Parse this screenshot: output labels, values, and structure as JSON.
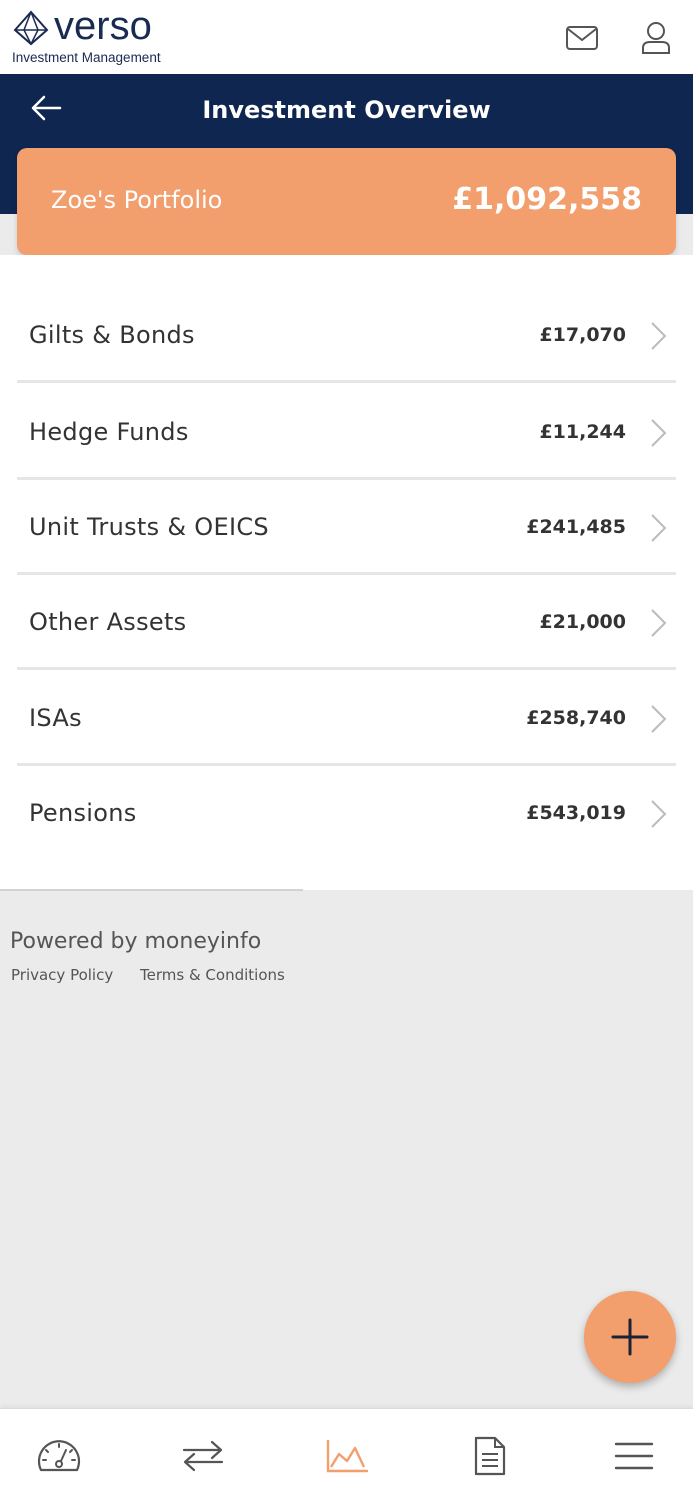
{
  "brand": {
    "name": "verso",
    "tagline": "Investment Management"
  },
  "header": {
    "title": "Investment Overview",
    "icons": [
      "mail-icon",
      "user-icon",
      "back-arrow-icon"
    ]
  },
  "portfolio": {
    "name": "Zoe's Portfolio",
    "value": "£1,092,558"
  },
  "assets": [
    {
      "label": "Gilts & Bonds",
      "value": "£17,070"
    },
    {
      "label": "Hedge Funds",
      "value": "£11,244"
    },
    {
      "label": "Unit Trusts & OEICS",
      "value": "£241,485"
    },
    {
      "label": "Other Assets",
      "value": "£21,000"
    },
    {
      "label": "ISAs",
      "value": "£258,740"
    },
    {
      "label": "Pensions",
      "value": "£543,019"
    }
  ],
  "footer": {
    "powered_by": "Powered by moneyinfo",
    "privacy": "Privacy Policy",
    "terms": "Terms & Conditions"
  },
  "bottom_nav": {
    "items": [
      "dashboard-icon",
      "transfer-icon",
      "chart-icon",
      "document-icon",
      "menu-icon"
    ],
    "active": "chart-icon"
  },
  "colors": {
    "navy": "#0e2650",
    "accent": "#f29e6d",
    "background": "#ebebeb"
  }
}
